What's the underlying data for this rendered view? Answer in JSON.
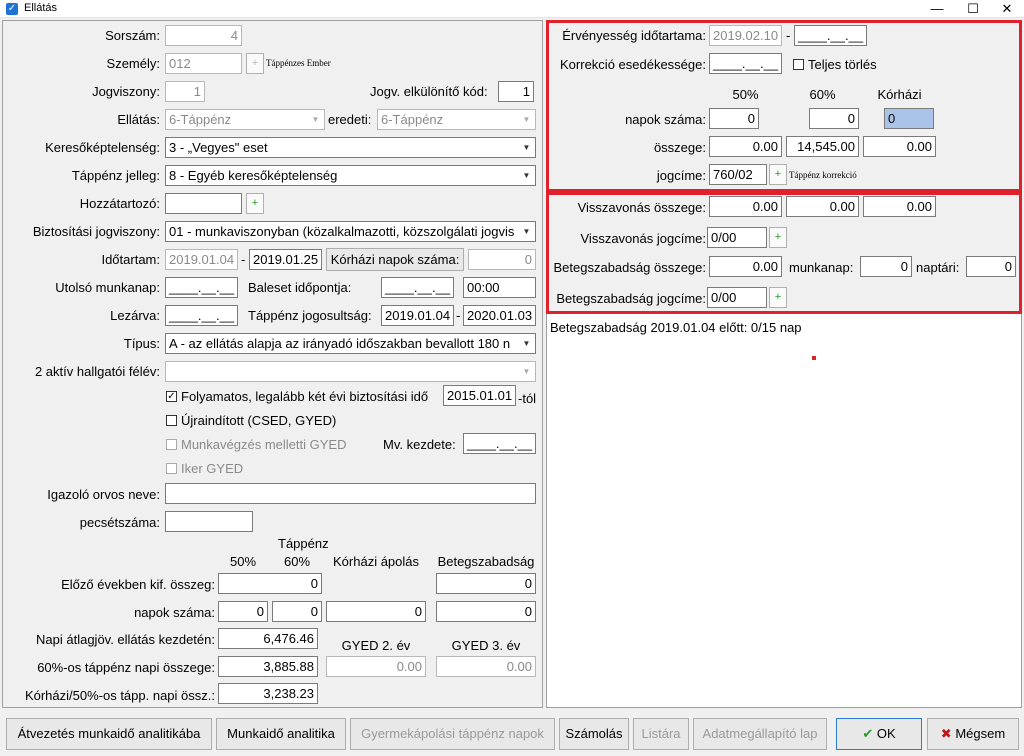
{
  "window": {
    "title": "Ellátás",
    "minimize": "—",
    "maximize": "☐",
    "close": "✕"
  },
  "left": {
    "sorszam": {
      "label": "Sorszám:",
      "value": "4"
    },
    "szemely": {
      "label": "Személy:",
      "value": "012",
      "link": "Táppénzes Ember"
    },
    "jogviszony": {
      "label": "Jogviszony:",
      "value": "1"
    },
    "jogv_kod": {
      "label": "Jogv. elkülönítő kód:",
      "value": "1"
    },
    "ellatas": {
      "label": "Ellátás:",
      "value": "6-Táppénz"
    },
    "eredeti": {
      "label": "eredeti:",
      "value": "6-Táppénz"
    },
    "keresokept": {
      "label": "Keresőképtelenség:",
      "value": "3 - „Vegyes\" eset"
    },
    "tappenz_jelleg": {
      "label": "Táppénz jelleg:",
      "value": "8 - Egyéb keresőképtelenség"
    },
    "hozzatartozo": {
      "label": "Hozzátartozó:",
      "value": ""
    },
    "biztositasi": {
      "label": "Biztosítási jogviszony:",
      "value": "01 - munkaviszonyban (közalkalmazotti, közszolgálati jogvis"
    },
    "idotartam": {
      "label": "Időtartam:",
      "from": "2019.01.04",
      "sep": "-",
      "to": "2019.01.25"
    },
    "korhazi_napok": {
      "label": "Kórházi napok száma:",
      "value": "0"
    },
    "utolso_munkanap": {
      "label": "Utolsó munkanap:",
      "value": "____.__.__"
    },
    "baleset": {
      "label": "Baleset időpontja:",
      "value": "____.__.__",
      "time": "00:00"
    },
    "lezarva": {
      "label": "Lezárva:",
      "value": "____.__.__"
    },
    "tappenz_jogosultsag": {
      "label": "Táppénz jogosultság:",
      "from": "2019.01.04",
      "sep": "-",
      "to": "2020.01.03"
    },
    "tipus": {
      "label": "Típus:",
      "value": "A - az ellátás alapja az irányadó időszakban bevallott 180 n"
    },
    "hallgatoi": {
      "label": "2 aktív hallgatói félév:",
      "value": ""
    },
    "folyamatos": {
      "label": "Folyamatos, legalább két évi biztosítási idő",
      "value": "2015.01.01",
      "suffix": "-tól",
      "mark": "✓"
    },
    "ujrainditott": {
      "label": "Újraindított (CSED, GYED)"
    },
    "munkavegzes": {
      "label": "Munkavégzés melletti GYED"
    },
    "mv_kezdete": {
      "label": "Mv. kezdete:",
      "value": "____.__.__"
    },
    "iker": {
      "label": "Iker GYED"
    },
    "igazolo": {
      "label": "Igazoló orvos neve:",
      "value": ""
    },
    "pecset": {
      "label": "pecsétszáma:",
      "value": ""
    },
    "table": {
      "tappenz": "Táppénz",
      "col50": "50%",
      "col60": "60%",
      "korhazi": "Kórházi ápolás",
      "beteg": "Betegszabadság",
      "elozo": {
        "label": "Előző években kif. összeg:",
        "v1": "0",
        "v4": "0"
      },
      "napok": {
        "label": "napok száma:",
        "v1": "0",
        "v2": "0",
        "v3": "0",
        "v4": "0"
      },
      "napi_atlag": {
        "label": "Napi átlagjöv. ellátás kezdetén:",
        "value": "6,476.46"
      },
      "gyed2": "GYED 2. év",
      "gyed3": "GYED 3. év",
      "napi60": {
        "label": "60%-os táppénz napi összege:",
        "value": "3,885.88",
        "g2": "0.00",
        "g3": "0.00"
      },
      "korhazi50": {
        "label": "Kórházi/50%-os tápp. napi össz.:",
        "value": "3,238.23"
      }
    }
  },
  "right": {
    "ervenyesseg": {
      "label": "Érvényesség időtartama:",
      "from": "2019.02.10",
      "sep": "-",
      "to": "____.__.__"
    },
    "korrekcio": {
      "label": "Korrekció esedékessége:",
      "value": "____.__.__"
    },
    "teljes_torles": {
      "label": "Teljes törlés"
    },
    "col50": "50%",
    "col60": "60%",
    "colk": "Kórházi",
    "napok": {
      "label": "napok száma:",
      "v50": "0",
      "v60": "0",
      "vk": "0"
    },
    "osszege": {
      "label": "összege:",
      "v50": "0.00",
      "v60": "14,545.00",
      "vk": "0.00"
    },
    "jogcime": {
      "label": "jogcíme:",
      "value": "760/02",
      "link": "Táppénz korrekció"
    },
    "visszavonas_osszege": {
      "label": "Visszavonás összege:",
      "v50": "0.00",
      "v60": "0.00",
      "vk": "0.00"
    },
    "visszavonas_jogcime": {
      "label": "Visszavonás jogcíme:",
      "value": "0/00"
    },
    "beteg_osszege": {
      "label": "Betegszabadság összege:",
      "value": "0.00",
      "munkanap_label": "munkanap:",
      "munkanap": "0",
      "naptari_label": "naptári:",
      "naptari": "0"
    },
    "beteg_jogcime": {
      "label": "Betegszabadság jogcíme:",
      "value": "0/00"
    },
    "info": "Betegszabadság 2019.01.04 előtt: 0/15 nap"
  },
  "buttons": {
    "atvezetes": "Átvezetés munkaidő analitikába",
    "munkaido": "Munkaidő analitika",
    "gyermek": "Gyermekápolási táppénz napok",
    "szamolas": "Számolás",
    "listara": "Listára",
    "adatmeg": "Adatmegállapító lap",
    "ok": "OK",
    "ok_icon": "✔",
    "megsem": "Mégsem",
    "megsem_icon": "✖"
  },
  "colors": {
    "highlight": "#e0202a",
    "ok_check": "#2a9a2a",
    "cancel_x": "#c01818",
    "selected_field": "#a9c4e8"
  }
}
